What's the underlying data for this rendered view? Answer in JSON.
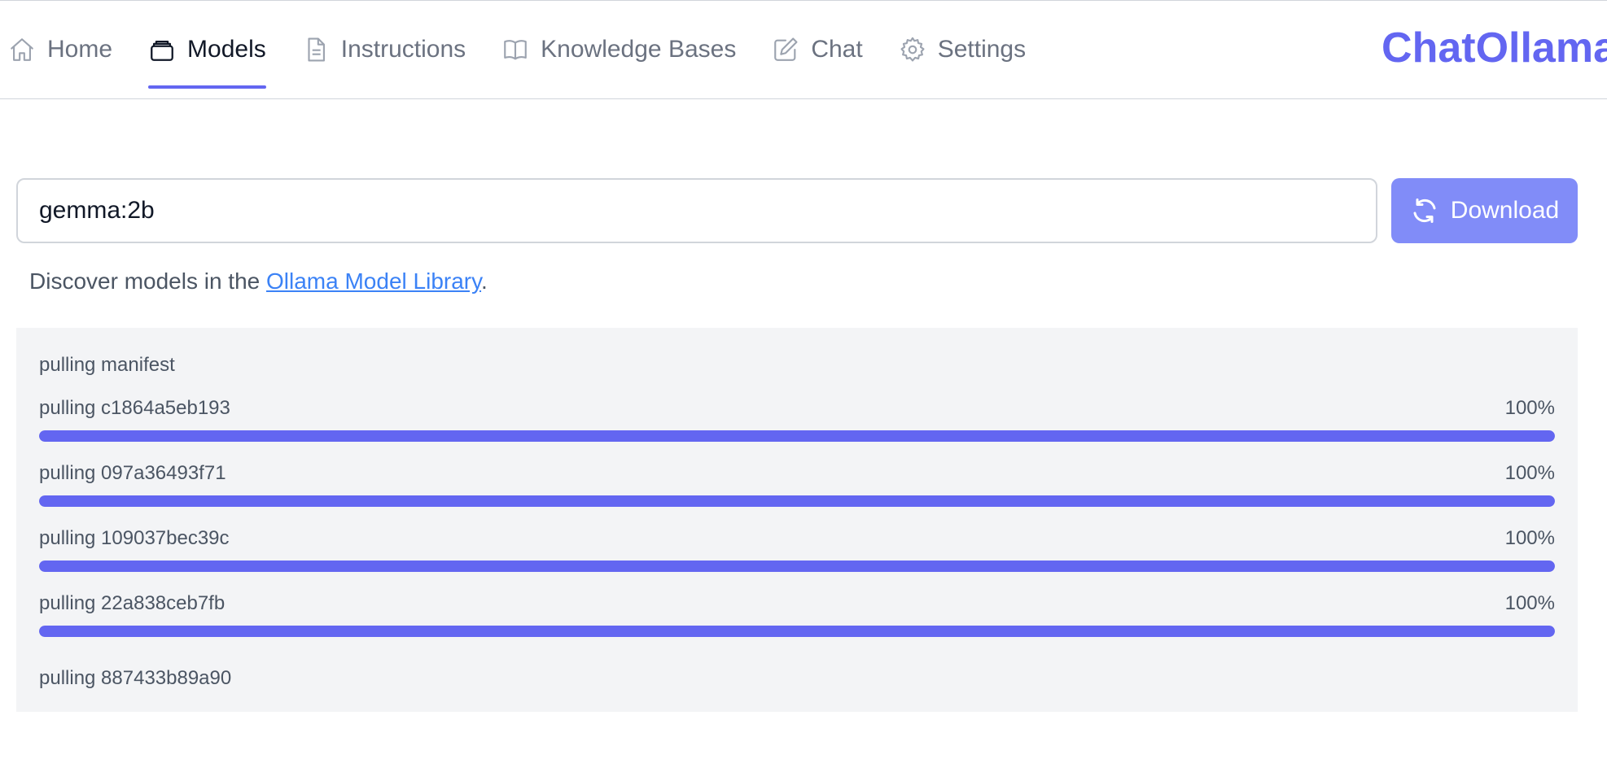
{
  "nav": {
    "items": [
      {
        "label": "Home",
        "icon": "home-icon",
        "active": false
      },
      {
        "label": "Models",
        "icon": "models-icon",
        "active": true
      },
      {
        "label": "Instructions",
        "icon": "document-icon",
        "active": false
      },
      {
        "label": "Knowledge Bases",
        "icon": "book-icon",
        "active": false
      },
      {
        "label": "Chat",
        "icon": "pencil-icon",
        "active": false
      },
      {
        "label": "Settings",
        "icon": "gear-icon",
        "active": false
      }
    ]
  },
  "brand": "ChatOllama",
  "search": {
    "value": "gemma:2b",
    "download_label": "Download",
    "download_icon": "refresh-icon"
  },
  "discover": {
    "prefix": "Discover models in the ",
    "link_text": "Ollama Model Library",
    "suffix": "."
  },
  "progress": {
    "manifest_text": "pulling manifest",
    "items": [
      {
        "label": "pulling c1864a5eb193",
        "percent_label": "100%",
        "percent": 100
      },
      {
        "label": "pulling 097a36493f71",
        "percent_label": "100%",
        "percent": 100
      },
      {
        "label": "pulling 109037bec39c",
        "percent_label": "100%",
        "percent": 100
      },
      {
        "label": "pulling 22a838ceb7fb",
        "percent_label": "100%",
        "percent": 100
      }
    ],
    "last_text": "pulling 887433b89a90"
  },
  "colors": {
    "accent": "#6366f1",
    "button": "#818cf8",
    "link": "#3b82f6",
    "panel": "#f3f4f6"
  }
}
